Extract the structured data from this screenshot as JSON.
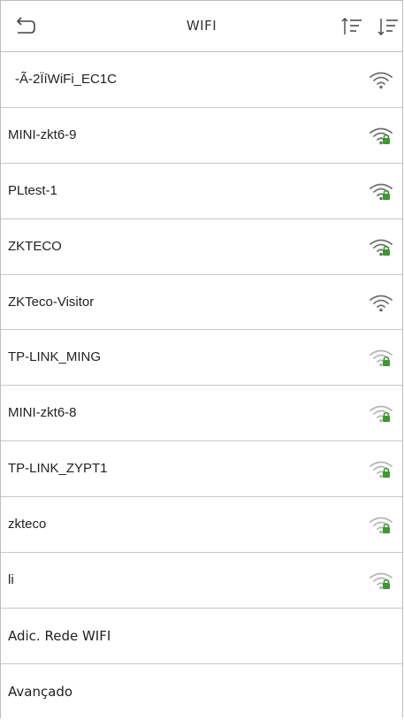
{
  "header": {
    "title": "WIFI"
  },
  "networks": [
    {
      "ssid": "-Ã-2ÏíWiFi_EC1C",
      "strength": "strong",
      "locked": false,
      "signal_color": "#707070"
    },
    {
      "ssid": "MINI-zkt6-9",
      "strength": "strong",
      "locked": true,
      "signal_color": "#707070"
    },
    {
      "ssid": "PLtest-1",
      "strength": "strong",
      "locked": true,
      "signal_color": "#707070"
    },
    {
      "ssid": "ZKTECO",
      "strength": "strong",
      "locked": true,
      "signal_color": "#707070"
    },
    {
      "ssid": "ZKTeco-Visitor",
      "strength": "strong",
      "locked": false,
      "signal_color": "#707070"
    },
    {
      "ssid": "TP-LINK_MING",
      "strength": "weak",
      "locked": true,
      "signal_color": "#b5b5b5"
    },
    {
      "ssid": "MINI-zkt6-8",
      "strength": "weak",
      "locked": true,
      "signal_color": "#b5b5b5"
    },
    {
      "ssid": "TP-LINK_ZYPT1",
      "strength": "weak",
      "locked": true,
      "signal_color": "#b5b5b5"
    },
    {
      "ssid": "zkteco",
      "strength": "weak",
      "locked": true,
      "signal_color": "#b5b5b5"
    },
    {
      "ssid": "li",
      "strength": "weak",
      "locked": true,
      "signal_color": "#b5b5b5"
    }
  ],
  "actions": {
    "add_network": "Adic. Rede WIFI",
    "advanced": "Avançado"
  },
  "colors": {
    "lock": "#3c9a2e",
    "divider": "#c8c8c8",
    "text": "#222222"
  }
}
